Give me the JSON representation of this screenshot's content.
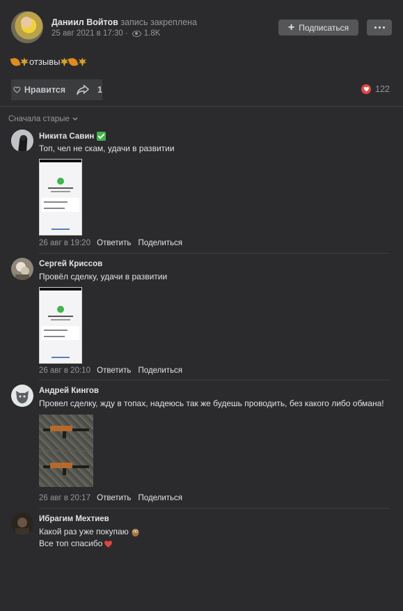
{
  "post": {
    "author": "Даниил Войтов",
    "pinned_note": "запись закреплена",
    "date": "25 авг 2021 в 17:30 ·",
    "views": "1.8K",
    "subscribe_label": "Подписаться",
    "text": "отзывы",
    "like_label": "Нравится",
    "shares": "1",
    "reactions_count": "122"
  },
  "sort_label": "Сначала старые",
  "comments": [
    {
      "author": "Никита Савин",
      "verified_emoji": "check-mark-emoji",
      "text": "Топ, чел не скам, удачи в развитии",
      "date": "26 авг в 19:20",
      "reply": "Ответить",
      "share": "Поделиться"
    },
    {
      "author": "Сергей Криссов",
      "text": "Провёл сделку, удачи в развитии",
      "date": "26 авг в 20:10",
      "reply": "Ответить",
      "share": "Поделиться"
    },
    {
      "author": "Андрей Кингов",
      "text": "Провел сделку, жду в топах, надеюсь так же будешь проводить, без какого либо обмана!",
      "date": "26 авг в 20:17",
      "reply": "Ответить",
      "share": "Поделиться"
    },
    {
      "author": "Ибрагим Мехтиев",
      "text_line1": "Какой раз уже покупаю",
      "text_line2": "Все топ спасибо"
    }
  ],
  "colors": {
    "background": "#2b2b2d",
    "button": "#555658",
    "text": "#e1e3e6",
    "muted": "#939699",
    "like_red": "#e64646",
    "check_green": "#3fb54a"
  },
  "icons": [
    "heart-icon",
    "share-arrow-icon",
    "eye-icon",
    "plus-icon",
    "more-dots-icon",
    "chevron-down-icon",
    "leaf-emoji",
    "maple-leaf-emoji",
    "owl-emoji",
    "heart-emoji"
  ]
}
